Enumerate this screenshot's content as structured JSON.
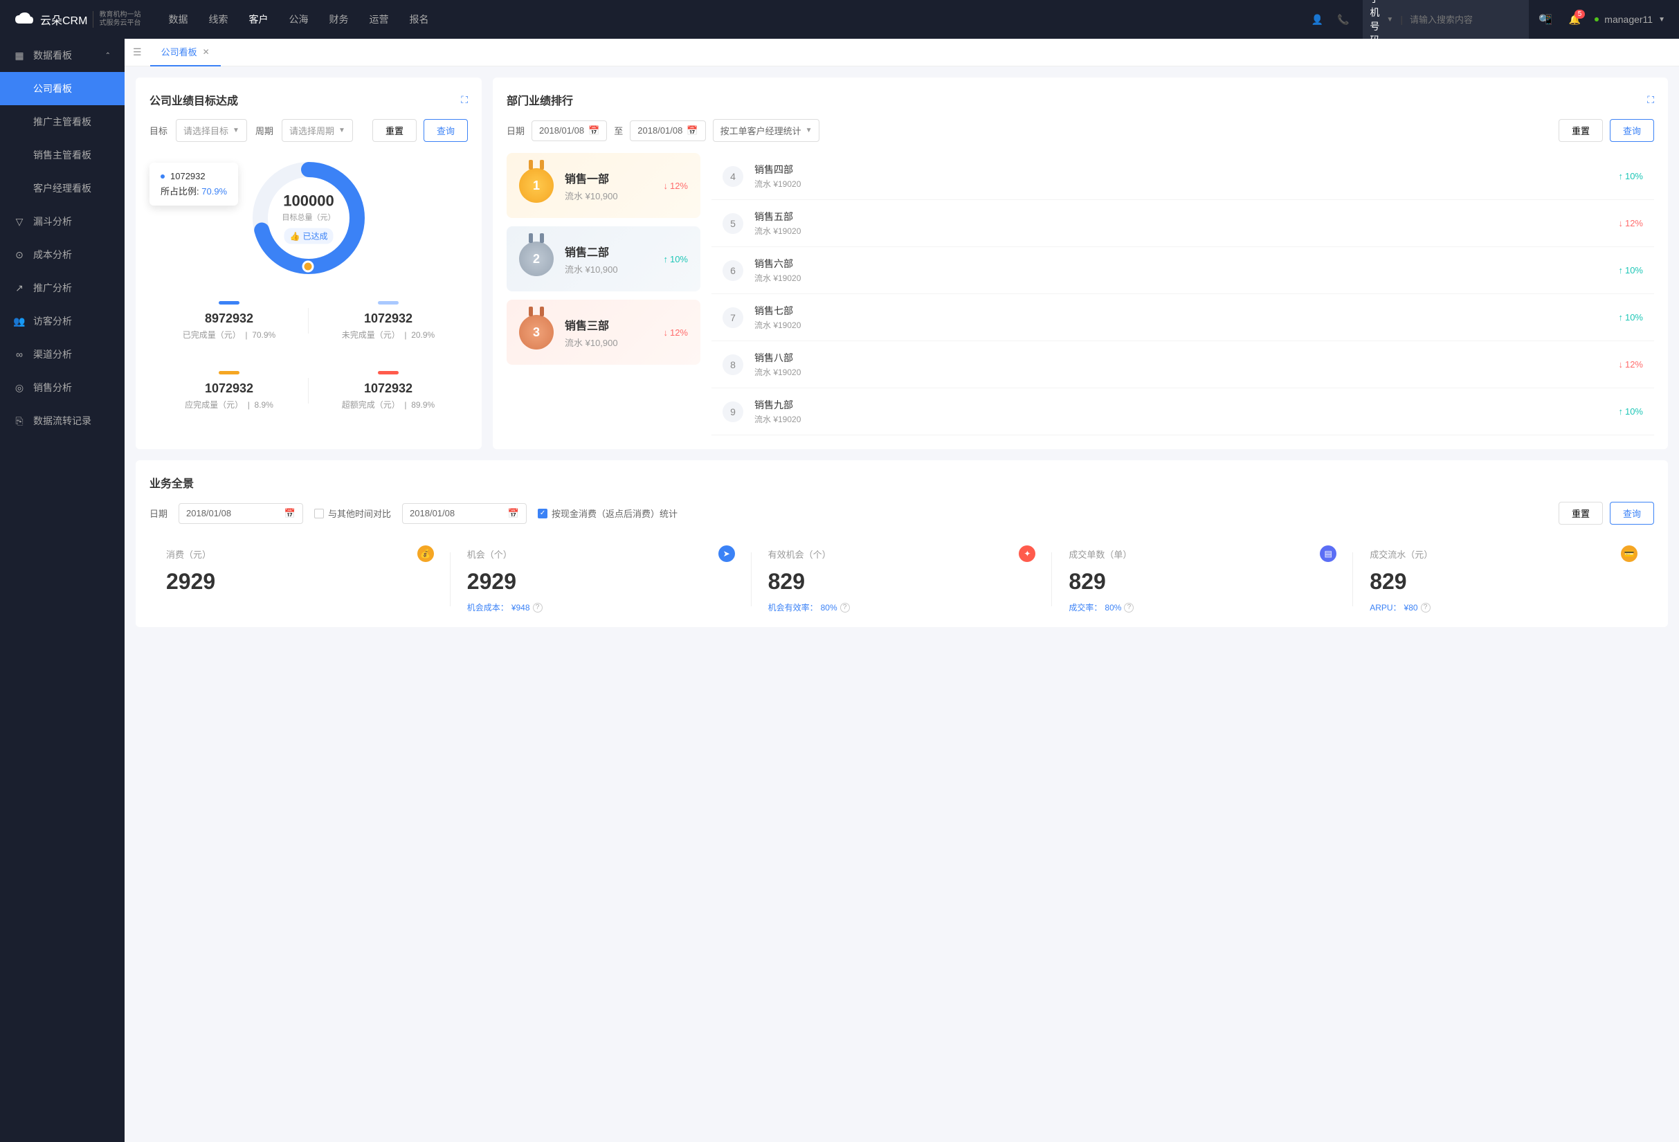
{
  "header": {
    "logo_main": "云朵CRM",
    "logo_sub1": "教育机构一站",
    "logo_sub2": "式服务云平台",
    "nav": [
      "数据",
      "线索",
      "客户",
      "公海",
      "财务",
      "运营",
      "报名"
    ],
    "active_nav": 2,
    "search_type": "手机号码",
    "search_placeholder": "请输入搜索内容",
    "badge": "5",
    "user": "manager11"
  },
  "sidebar": {
    "group_title": "数据看板",
    "sub": [
      "公司看板",
      "推广主管看板",
      "销售主管看板",
      "客户经理看板"
    ],
    "active_sub": 0,
    "items": [
      "漏斗分析",
      "成本分析",
      "推广分析",
      "访客分析",
      "渠道分析",
      "销售分析",
      "数据流转记录"
    ]
  },
  "tabs": {
    "tab1": "公司看板"
  },
  "panel1": {
    "title": "公司业绩目标达成",
    "target_label": "目标",
    "target_placeholder": "请选择目标",
    "period_label": "周期",
    "period_placeholder": "请选择周期",
    "btn_reset": "重置",
    "btn_query": "查询",
    "donut_value": "100000",
    "donut_label": "目标总量（元）",
    "donut_tag": "已达成",
    "tooltip_value": "1072932",
    "tooltip_label": "所占比例:",
    "tooltip_pct": "70.9%",
    "stats": [
      {
        "bar": "#3b82f6",
        "value": "8972932",
        "label": "已完成量（元）",
        "pct": "70.9%"
      },
      {
        "bar": "#a9c9ff",
        "value": "1072932",
        "label": "未完成量（元）",
        "pct": "20.9%"
      },
      {
        "bar": "#f5a623",
        "value": "1072932",
        "label": "应完成量（元）",
        "pct": "8.9%"
      },
      {
        "bar": "#ff5b4c",
        "value": "1072932",
        "label": "超额完成（元）",
        "pct": "89.9%"
      }
    ]
  },
  "panel2": {
    "title": "部门业绩排行",
    "date_label": "日期",
    "date1": "2018/01/08",
    "date_to": "至",
    "date2": "2018/01/08",
    "stat_type": "按工单客户经理统计",
    "btn_reset": "重置",
    "btn_query": "查询",
    "top3": [
      {
        "rank": "1",
        "name": "销售一部",
        "sub": "流水 ¥10,900",
        "pct": "12%",
        "dir": "down"
      },
      {
        "rank": "2",
        "name": "销售二部",
        "sub": "流水 ¥10,900",
        "pct": "10%",
        "dir": "up"
      },
      {
        "rank": "3",
        "name": "销售三部",
        "sub": "流水 ¥10,900",
        "pct": "12%",
        "dir": "down"
      }
    ],
    "rest": [
      {
        "rank": "4",
        "name": "销售四部",
        "sub": "流水 ¥19020",
        "pct": "10%",
        "dir": "up"
      },
      {
        "rank": "5",
        "name": "销售五部",
        "sub": "流水 ¥19020",
        "pct": "12%",
        "dir": "down"
      },
      {
        "rank": "6",
        "name": "销售六部",
        "sub": "流水 ¥19020",
        "pct": "10%",
        "dir": "up"
      },
      {
        "rank": "7",
        "name": "销售七部",
        "sub": "流水 ¥19020",
        "pct": "10%",
        "dir": "up"
      },
      {
        "rank": "8",
        "name": "销售八部",
        "sub": "流水 ¥19020",
        "pct": "12%",
        "dir": "down"
      },
      {
        "rank": "9",
        "name": "销售九部",
        "sub": "流水 ¥19020",
        "pct": "10%",
        "dir": "up"
      }
    ]
  },
  "panel3": {
    "title": "业务全景",
    "date_label": "日期",
    "date1": "2018/01/08",
    "compare_label": "与其他时间对比",
    "date2": "2018/01/08",
    "cash_label": "按现金消费（返点后消费）统计",
    "btn_reset": "重置",
    "btn_query": "查询",
    "kpi": [
      {
        "label": "消费（元）",
        "value": "2929",
        "foot": "",
        "icon": "#f5a623",
        "glyph": "💰"
      },
      {
        "label": "机会（个）",
        "value": "2929",
        "foot_k": "机会成本：",
        "foot_v": "¥948",
        "icon": "#3b82f6",
        "glyph": "➤"
      },
      {
        "label": "有效机会（个）",
        "value": "829",
        "foot_k": "机会有效率：",
        "foot_v": "80%",
        "icon": "#ff5b4c",
        "glyph": "✦"
      },
      {
        "label": "成交单数（单）",
        "value": "829",
        "foot_k": "成交率：",
        "foot_v": "80%",
        "icon": "#5b6ef5",
        "glyph": "▤"
      },
      {
        "label": "成交流水（元）",
        "value": "829",
        "foot_k": "ARPU：",
        "foot_v": "¥80",
        "icon": "#f5a623",
        "glyph": "💳"
      }
    ]
  },
  "chart_data": {
    "type": "pie",
    "title": "公司业绩目标达成",
    "total_label": "目标总量（元）",
    "total": 100000,
    "series": [
      {
        "name": "已完成量（元）",
        "value": 8972932,
        "pct": 70.9,
        "color": "#3b82f6"
      },
      {
        "name": "未完成量（元）",
        "value": 1072932,
        "pct": 20.9,
        "color": "#a9c9ff"
      },
      {
        "name": "应完成量（元）",
        "value": 1072932,
        "pct": 8.9,
        "color": "#f5a623"
      },
      {
        "name": "超额完成（元）",
        "value": 1072932,
        "pct": 89.9,
        "color": "#ff5b4c"
      }
    ],
    "highlighted": {
      "name": "所占比例",
      "value": 1072932,
      "pct": 70.9
    }
  }
}
